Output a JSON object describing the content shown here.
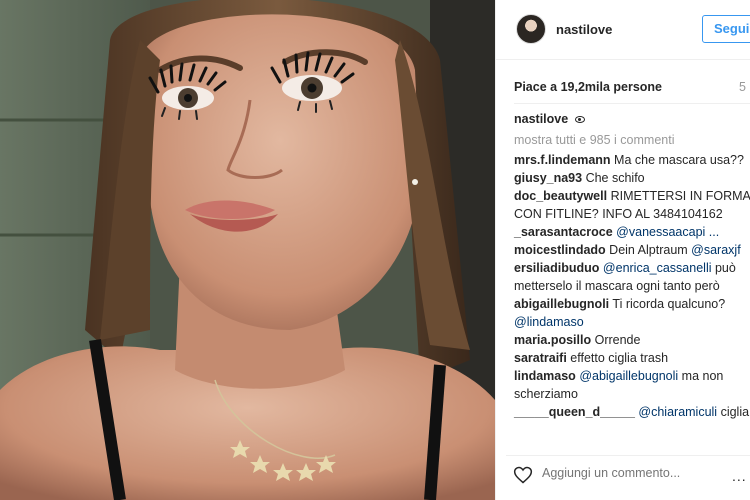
{
  "post": {
    "photo_alt": "",
    "header": {
      "username": "nastilove",
      "follow_label": "Segui"
    },
    "likes": {
      "text": "Piace a 19,2mila persone",
      "age": "5"
    },
    "caption": {
      "username": "nastilove",
      "icon": "eye-icon"
    },
    "view_all_comments": "mostra tutti e 985 i commenti",
    "comments": [
      {
        "user": "mrs.f.lindemann",
        "parts": [
          {
            "t": "Ma che mascara usa??"
          }
        ]
      },
      {
        "user": "giusy_na93",
        "parts": [
          {
            "t": "Che schifo"
          }
        ]
      },
      {
        "user": "doc_beautywell",
        "parts": [
          {
            "t": "RIMETTERSI IN FORMA CON FITLINE? INFO AL 3484104162"
          }
        ]
      },
      {
        "user": "_sarasantacroce",
        "parts": [
          {
            "t": "@vanessaacapi ...",
            "mention": true
          }
        ]
      },
      {
        "user": "moicestlindado",
        "parts": [
          {
            "t": "Dein Alptraum "
          },
          {
            "t": "@saraxjf",
            "mention": true
          }
        ]
      },
      {
        "user": "ersiliadibuduo",
        "parts": [
          {
            "t": "@enrica_cassanelli",
            "mention": true
          },
          {
            "t": " può metterselo il mascara ogni tanto però"
          }
        ]
      },
      {
        "user": "abigaillebugnoli",
        "parts": [
          {
            "t": "Ti ricorda qualcuno? "
          },
          {
            "t": "@lindamaso",
            "mention": true
          }
        ]
      },
      {
        "user": "maria.posillo",
        "parts": [
          {
            "t": "Orrende"
          }
        ]
      },
      {
        "user": "saratraifi",
        "parts": [
          {
            "t": "effetto ciglia trash"
          }
        ]
      },
      {
        "user": "lindamaso",
        "parts": [
          {
            "t": "@abigaillebugnoli",
            "mention": true
          },
          {
            "t": " ma non scherziamo"
          }
        ]
      },
      {
        "user": "_____queen_d_____",
        "parts": [
          {
            "t": "@chiaramiculi",
            "mention": true
          },
          {
            "t": " ciglia"
          }
        ]
      }
    ],
    "composer": {
      "placeholder": "Aggiungi un commento...",
      "like_icon": "heart-outline-icon",
      "more_icon": "more-options-icon",
      "more_label": "..."
    },
    "colors": {
      "link": "#003569",
      "follow": "#3897f0",
      "muted": "#999999"
    }
  }
}
